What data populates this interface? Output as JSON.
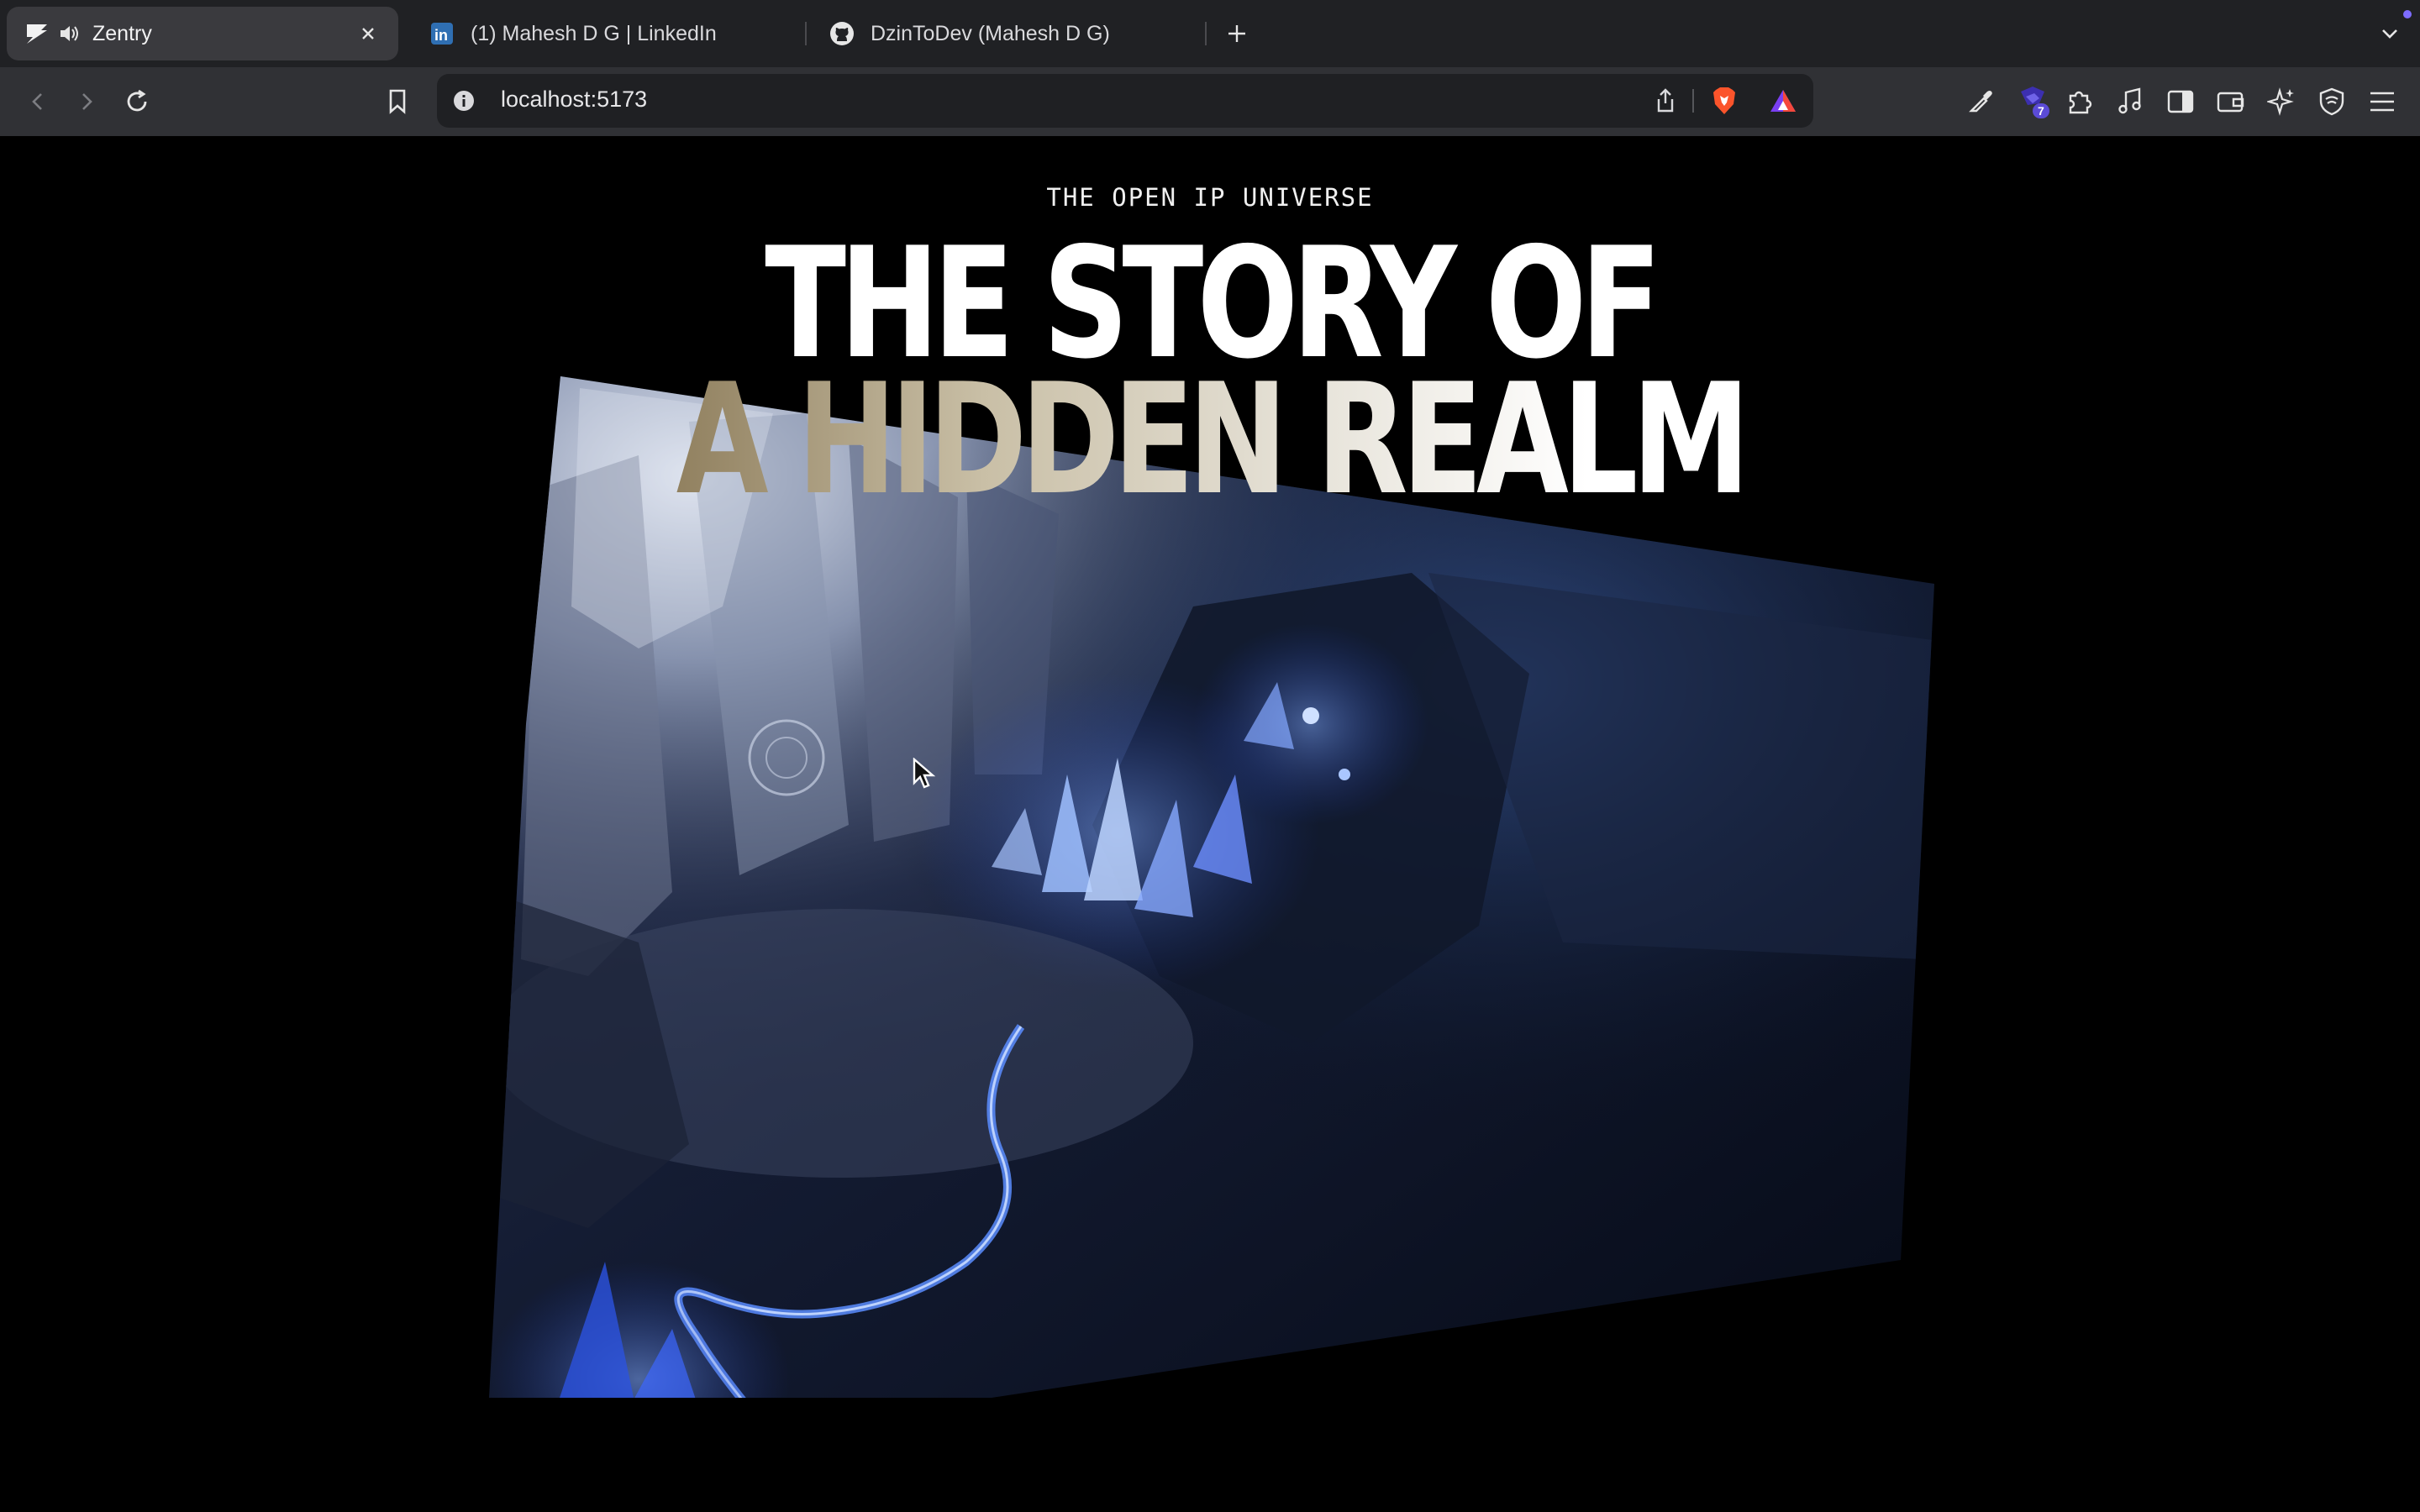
{
  "browser": {
    "tabs": [
      {
        "title": "Zentry",
        "favicon": "zentry-logo-icon",
        "active": true,
        "audio": true
      },
      {
        "title": "(1) Mahesh D G | LinkedIn",
        "favicon": "linkedin-icon",
        "active": false
      },
      {
        "title": "DzinToDev (Mahesh D G)",
        "favicon": "github-icon",
        "active": false
      }
    ],
    "address": {
      "url": "localhost:5173"
    },
    "extension_badge": "7",
    "accent_colors": {
      "brave": "#fb542b",
      "badge": "#5b4bd6",
      "notification_dot": "#7d6cff"
    }
  },
  "page": {
    "kicker": "THE OPEN IP UNIVERSE",
    "headline_line1": "THE STORY OF",
    "headline_line2": "A HIDDEN REALM",
    "background": "#000000"
  }
}
